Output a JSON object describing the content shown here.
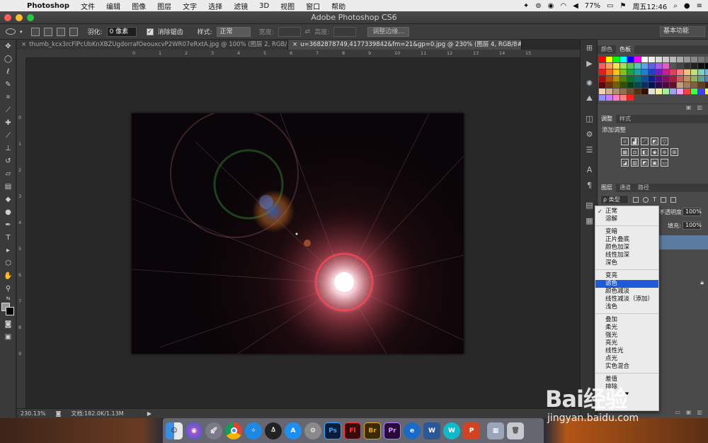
{
  "menubar": {
    "app_name": "Photoshop",
    "items": [
      "文件",
      "编辑",
      "图像",
      "图层",
      "文字",
      "选择",
      "滤镜",
      "3D",
      "视图",
      "窗口",
      "帮助"
    ],
    "battery": "77%",
    "clock": "周五12:46"
  },
  "window": {
    "title": "Adobe Photoshop CS6"
  },
  "options": {
    "feather_label": "羽化:",
    "feather_value": "0 像素",
    "antialias_label": "消除锯齿",
    "style_label": "样式:",
    "style_value": "正常",
    "width_label": "宽度:",
    "height_label": "高度:",
    "refine_edge": "调整边缘...",
    "workspace": "基本功能"
  },
  "tabs": [
    "thumb_kcx3rcFlPcUbKnXBZUgdorrafOeouxcvP2WR07eRxtA.jpg @ 100% (图层 2, RGB/8#) *",
    "u=3682878749,4177339842&fm=21&gp=0.jpg @ 230% (图层 4, RGB/8#) *"
  ],
  "rulers": {
    "top": [
      "0",
      "1",
      "2",
      "3",
      "4",
      "5",
      "6",
      "7",
      "8",
      "9",
      "10",
      "11",
      "12",
      "13",
      "14",
      "15"
    ],
    "left": [
      "0",
      "1",
      "2",
      "3",
      "4",
      "5",
      "6",
      "7",
      "8",
      "9"
    ]
  },
  "status": {
    "zoom": "230.13%",
    "doc": "文档:182.0K/1.13M"
  },
  "panels": {
    "swatch_tabs": [
      "颜色",
      "色板"
    ],
    "adjust_tabs": [
      "调整",
      "样式"
    ],
    "adjust_title": "添加调整",
    "layer_tabs": [
      "图层",
      "通道",
      "路径"
    ],
    "kind_label": "ρ 类型",
    "opacity_label": "不透明度:",
    "opacity_value": "100%",
    "fill_label": "填充:",
    "fill_value": "100%"
  },
  "blend_modes": {
    "groups": [
      [
        "正常",
        "溶解"
      ],
      [
        "变暗",
        "正片叠底",
        "颜色加深",
        "线性加深",
        "深色"
      ],
      [
        "变亮",
        "滤色",
        "颜色减淡",
        "线性减淡（添加）",
        "浅色"
      ],
      [
        "叠加",
        "柔光",
        "强光",
        "亮光",
        "线性光",
        "点光",
        "实色混合"
      ],
      [
        "差值",
        "排除"
      ]
    ],
    "checked": "正常",
    "selected": "滤色"
  },
  "dock_apps": [
    "Finder",
    "Siri",
    "Launchpad",
    "Chrome",
    "Safari",
    "QQ",
    "App Store",
    "System Preferences",
    "Ps",
    "Fl",
    "Br",
    "Pr",
    "Edge",
    "W",
    "WPS",
    "P",
    "Photos",
    "Trash"
  ],
  "watermark": {
    "brand": "Bai经验",
    "url": "jingyan.baidu.com"
  },
  "colors": {
    "selection": "#1f5bd6",
    "menu_bg": "#ebebeb",
    "panel_bg": "#4a4a4a"
  }
}
